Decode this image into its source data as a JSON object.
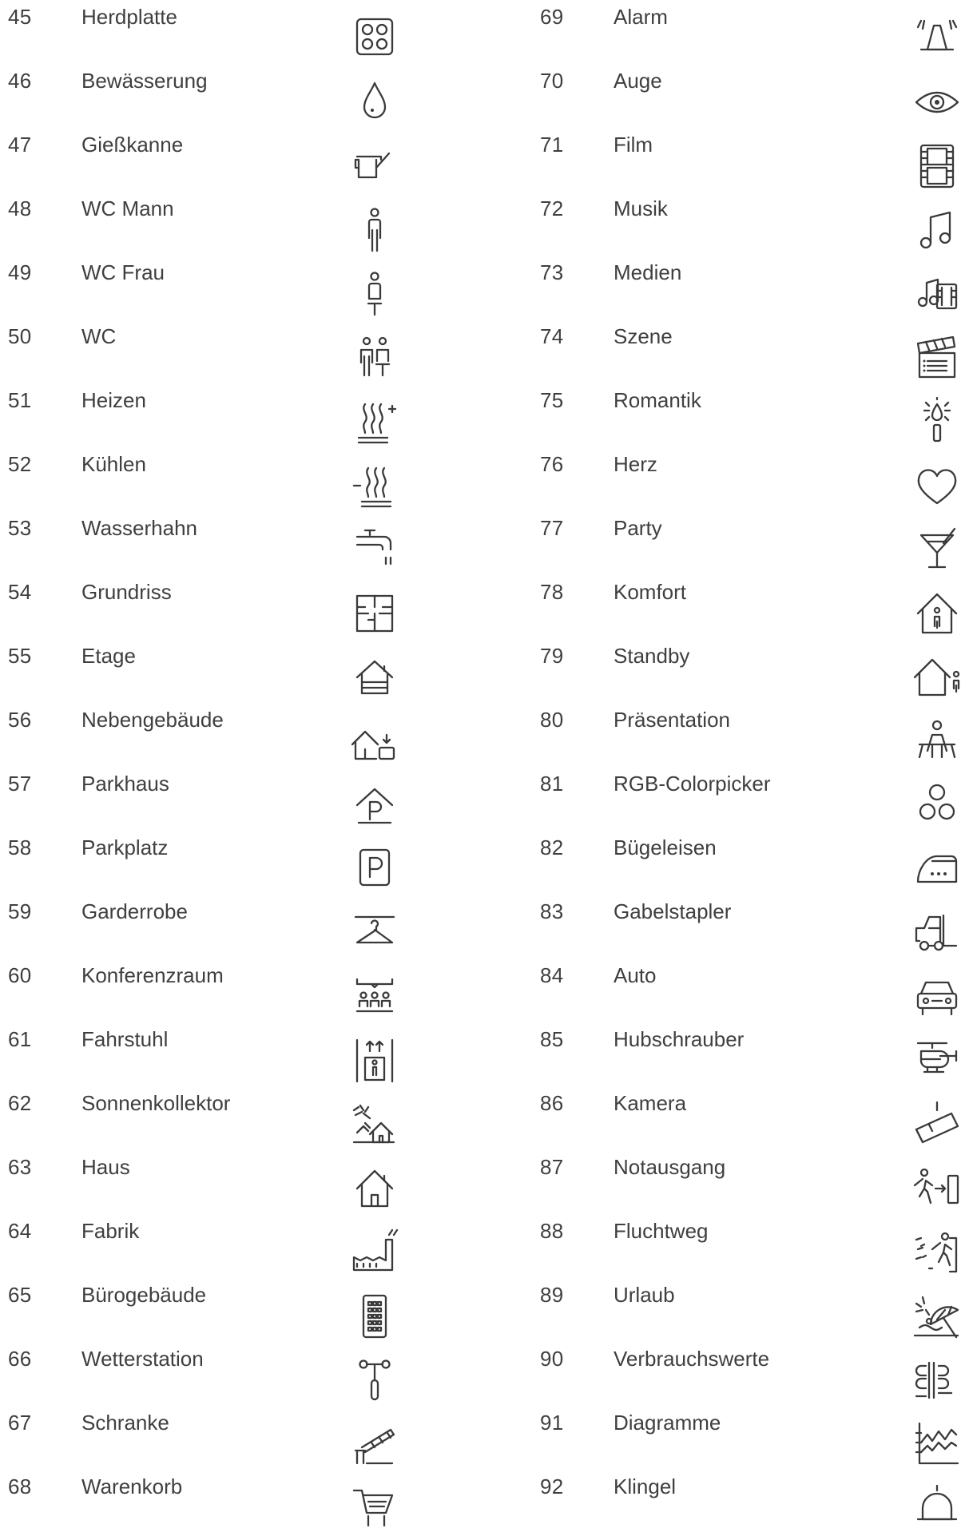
{
  "page": {
    "accent_color": "#3a3a3a",
    "background_color": "#ffffff"
  },
  "left_column": [
    {
      "number": "45",
      "label": "Herdplatte",
      "icon": "cooktop-icon"
    },
    {
      "number": "46",
      "label": "Bewässerung",
      "icon": "water-drop-icon"
    },
    {
      "number": "47",
      "label": "Gießkanne",
      "icon": "watering-can-icon"
    },
    {
      "number": "48",
      "label": "WC Mann",
      "icon": "man-icon"
    },
    {
      "number": "49",
      "label": "WC Frau",
      "icon": "woman-icon"
    },
    {
      "number": "50",
      "label": "WC",
      "icon": "restroom-icon"
    },
    {
      "number": "51",
      "label": "Heizen",
      "icon": "heat-plus-icon"
    },
    {
      "number": "52",
      "label": "Kühlen",
      "icon": "heat-minus-icon"
    },
    {
      "number": "53",
      "label": "Wasserhahn",
      "icon": "faucet-icon"
    },
    {
      "number": "54",
      "label": "Grundriss",
      "icon": "floor-plan-icon"
    },
    {
      "number": "55",
      "label": "Etage",
      "icon": "house-floors-icon"
    },
    {
      "number": "56",
      "label": "Nebengebäude",
      "icon": "outbuilding-icon"
    },
    {
      "number": "57",
      "label": "Parkhaus",
      "icon": "parking-garage-icon"
    },
    {
      "number": "58",
      "label": "Parkplatz",
      "icon": "parking-sign-icon"
    },
    {
      "number": "59",
      "label": "Garderrobe",
      "icon": "hanger-icon"
    },
    {
      "number": "60",
      "label": "Konferenzraum",
      "icon": "conference-icon"
    },
    {
      "number": "61",
      "label": "Fahrstuhl",
      "icon": "elevator-icon"
    },
    {
      "number": "62",
      "label": "Sonnenkollektor",
      "icon": "solar-house-icon"
    },
    {
      "number": "63",
      "label": "Haus",
      "icon": "house-icon"
    },
    {
      "number": "64",
      "label": "Fabrik",
      "icon": "factory-icon"
    },
    {
      "number": "65",
      "label": "Bürogebäude",
      "icon": "office-building-icon"
    },
    {
      "number": "66",
      "label": "Wetterstation",
      "icon": "weather-station-icon"
    },
    {
      "number": "67",
      "label": "Schranke",
      "icon": "barrier-gate-icon"
    },
    {
      "number": "68",
      "label": "Warenkorb",
      "icon": "shopping-cart-icon"
    }
  ],
  "right_column": [
    {
      "number": "69",
      "label": "Alarm",
      "icon": "alarm-bell-icon"
    },
    {
      "number": "70",
      "label": "Auge",
      "icon": "eye-icon"
    },
    {
      "number": "71",
      "label": "Film",
      "icon": "film-strip-icon"
    },
    {
      "number": "72",
      "label": "Musik",
      "icon": "music-note-icon"
    },
    {
      "number": "73",
      "label": "Medien",
      "icon": "media-icon"
    },
    {
      "number": "74",
      "label": "Szene",
      "icon": "clapperboard-icon"
    },
    {
      "number": "75",
      "label": "Romantik",
      "icon": "candle-icon"
    },
    {
      "number": "76",
      "label": "Herz",
      "icon": "heart-icon"
    },
    {
      "number": "77",
      "label": "Party",
      "icon": "cocktail-icon"
    },
    {
      "number": "78",
      "label": "Komfort",
      "icon": "comfort-house-icon"
    },
    {
      "number": "79",
      "label": "Standby",
      "icon": "standby-house-icon"
    },
    {
      "number": "80",
      "label": "Präsentation",
      "icon": "presenter-icon"
    },
    {
      "number": "81",
      "label": "RGB-Colorpicker",
      "icon": "rgb-circles-icon"
    },
    {
      "number": "82",
      "label": "Bügeleisen",
      "icon": "iron-icon"
    },
    {
      "number": "83",
      "label": "Gabelstapler",
      "icon": "forklift-icon"
    },
    {
      "number": "84",
      "label": "Auto",
      "icon": "car-icon"
    },
    {
      "number": "85",
      "label": "Hubschrauber",
      "icon": "helicopter-icon"
    },
    {
      "number": "86",
      "label": "Kamera",
      "icon": "security-camera-icon"
    },
    {
      "number": "87",
      "label": "Notausgang",
      "icon": "emergency-exit-icon"
    },
    {
      "number": "88",
      "label": "Fluchtweg",
      "icon": "escape-route-icon"
    },
    {
      "number": "89",
      "label": "Urlaub",
      "icon": "beach-umbrella-icon"
    },
    {
      "number": "90",
      "label": "Verbrauchswerte",
      "icon": "consumption-meter-icon"
    },
    {
      "number": "91",
      "label": "Diagramme",
      "icon": "line-chart-icon"
    },
    {
      "number": "92",
      "label": "Klingel",
      "icon": "doorbell-icon"
    }
  ]
}
